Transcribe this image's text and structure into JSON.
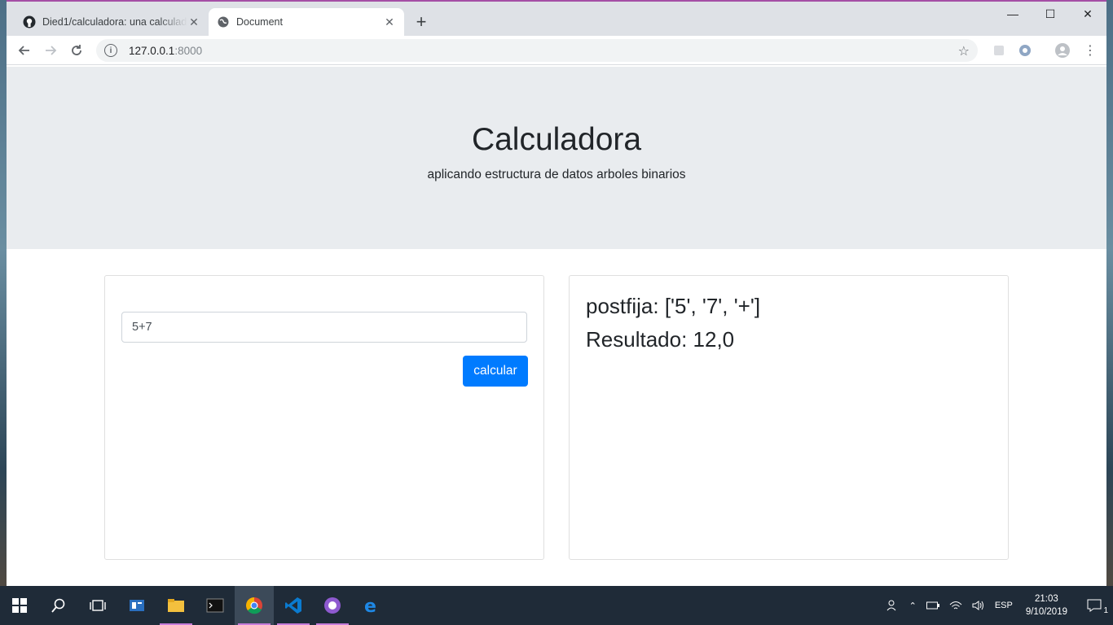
{
  "browser": {
    "tabs": [
      {
        "title": "Died1/calculadora: una calculadora",
        "active": false,
        "icon": "github-icon"
      },
      {
        "title": "Document",
        "active": true,
        "icon": "globe-icon"
      }
    ],
    "address": {
      "host": "127.0.0.1",
      "port": ":8000"
    }
  },
  "page": {
    "title": "Calculadora",
    "subtitle": "aplicando estructura de datos arboles binarios",
    "form": {
      "expression_value": "5+7",
      "submit_label": "calcular"
    },
    "result": {
      "postfix_line": "postfija: ['5', '7', '+']",
      "result_line": "Resultado: 12,0"
    }
  },
  "taskbar": {
    "language": "ESP",
    "time": "21:03",
    "date": "9/10/2019",
    "notification_count": "1"
  },
  "colors": {
    "primary_button": "#007bff",
    "jumbotron_bg": "#e9ecef",
    "taskbar_bg": "#1f2b38"
  }
}
